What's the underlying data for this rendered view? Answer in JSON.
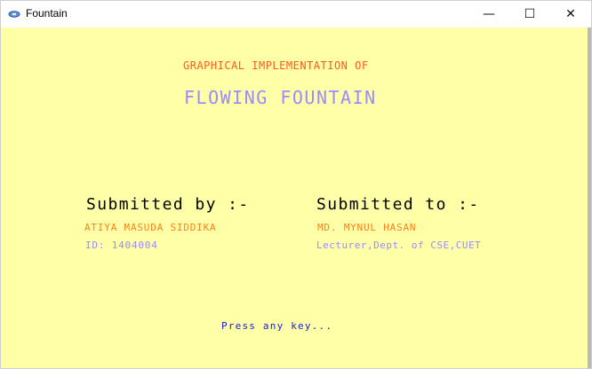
{
  "window": {
    "title": "Fountain",
    "controls": {
      "minimize": "—",
      "maximize": "☐",
      "close": "✕"
    }
  },
  "screen": {
    "heading_line1": "GRAPHICAL IMPLEMENTATION OF",
    "heading_line2": "FLOWING FOUNTAIN",
    "submitted_by": {
      "label": "Submitted by :-",
      "name": "ATIYA MASUDA SIDDIKA",
      "id": "ID: 1404004"
    },
    "submitted_to": {
      "label": "Submitted to :-",
      "name": "MD. MYNUL HASAN",
      "designation": "Lecturer,Dept. of CSE,CUET"
    },
    "prompt": "Press any key..."
  },
  "colors": {
    "background": "#ffffa8",
    "heading_orange": "#ff5a1e",
    "lavender": "#9a8bff",
    "name_orange": "#ff7f1a",
    "prompt_blue": "#1a22d4"
  }
}
